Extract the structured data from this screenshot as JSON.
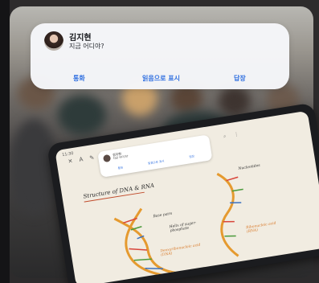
{
  "notification": {
    "sender": "김지현",
    "message": "지금 어디야?",
    "actions": {
      "call": "통화",
      "mark_read": "읽음으로 표시",
      "reply": "답장"
    }
  },
  "tablet_screen": {
    "status_time": "11:30",
    "mini_notification": {
      "sender": "김지현",
      "message": "지금 어디야?",
      "actions": {
        "call": "통화",
        "mark_read": "읽음으로 표시",
        "reply": "답장"
      }
    },
    "note_title": "Structure of DNA & RNA",
    "labels": {
      "base_pairs": "Base pairs",
      "helix": "Helix of sugar-phosphate",
      "ribonucleic_acid": "Ribonucleic acid (RNA)",
      "nucleotides": "Nucleotides",
      "deoxyribonucleic_acid": "Deoxyribonucleic acid (DNA)"
    }
  },
  "colors": {
    "accent": "#2f6fe0",
    "notification_bg": "#f6f7fa",
    "note_paper": "#f1ece1",
    "dna_orange": "#e59a2f"
  }
}
